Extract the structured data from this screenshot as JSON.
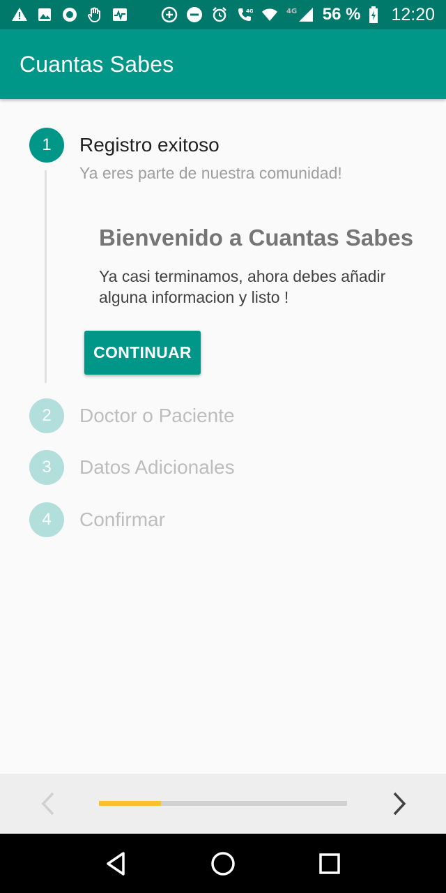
{
  "status_bar": {
    "battery_text": "56 %",
    "time": "12:20",
    "network": "4G",
    "icons": [
      "alert-icon",
      "image-icon",
      "record-icon",
      "hand-icon",
      "activity-icon",
      "add-circle-icon",
      "minus-circle-icon",
      "alarm-icon",
      "call-4g-icon",
      "wifi-icon",
      "signal-icon",
      "battery-icon"
    ]
  },
  "app_bar": {
    "title": "Cuantas Sabes"
  },
  "stepper": {
    "steps": [
      {
        "number": "1",
        "title": "Registro exitoso",
        "subtitle": "Ya eres parte de nuestra comunidad!",
        "state": "active"
      },
      {
        "number": "2",
        "title": "Doctor o Paciente",
        "state": "inactive"
      },
      {
        "number": "3",
        "title": "Datos Adicionales",
        "state": "inactive"
      },
      {
        "number": "4",
        "title": "Confirmar",
        "state": "inactive"
      }
    ],
    "content": {
      "heading": "Bienvenido a Cuantas Sabes",
      "body": "Ya casi terminamos, ahora debes añadir alguna informacion y listo !",
      "button_label": "CONTINUAR"
    }
  },
  "bottom_nav": {
    "progress": 0.25,
    "colors": {
      "progress_fill": "#fbc02d",
      "track": "#d0d0d0"
    }
  },
  "colors": {
    "primary": "#009688",
    "primary_dark": "#00796b",
    "primary_light": "#b2dfdb"
  }
}
